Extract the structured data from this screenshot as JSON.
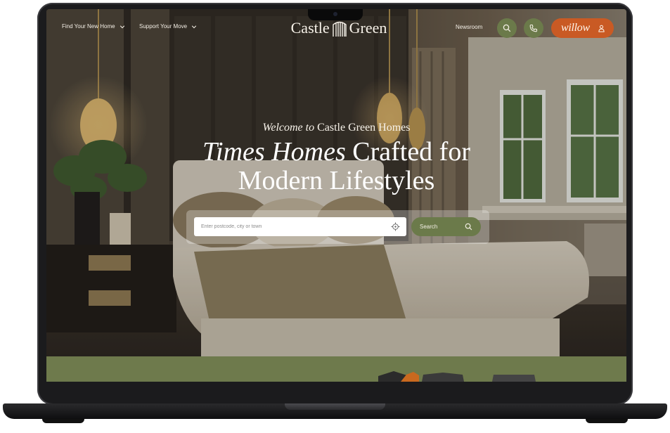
{
  "nav": {
    "find_home": "Find Your New Home",
    "support_move": "Support Your Move",
    "logo_left": "Castle",
    "logo_right": "Green",
    "newsroom": "Newsroom",
    "search_icon": "search-icon",
    "phone_icon": "phone-icon",
    "willow_label": "willow",
    "user_icon": "user-icon"
  },
  "hero": {
    "welcome_italic": "Welcome to",
    "welcome_rest": "Castle Green Homes",
    "headline_italic": "Times Homes",
    "headline_rest_1": "Crafted for",
    "headline_line_2": "Modern Lifestyles"
  },
  "search": {
    "placeholder": "Enter postcode, city or town",
    "button_label": "Search",
    "locate_icon": "crosshair-icon"
  },
  "colors": {
    "brand_green": "#6b7a4a",
    "accent_orange": "#c95a24",
    "text_light": "#f6f1e8"
  }
}
